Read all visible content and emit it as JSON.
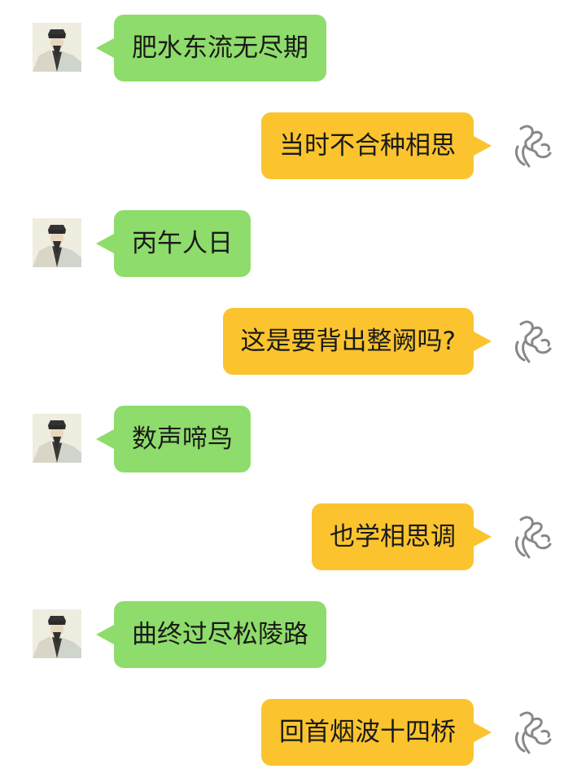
{
  "colors": {
    "incoming_bubble": "#8edc6b",
    "outgoing_bubble": "#fbc42e",
    "background": "#ffffff"
  },
  "messages": [
    {
      "side": "left",
      "text": "肥水东流无尽期",
      "avatar": "scholar-portrait"
    },
    {
      "side": "right",
      "text": "当时不合种相思",
      "avatar": "sketch-avatar"
    },
    {
      "side": "left",
      "text": "丙午人日",
      "avatar": "scholar-portrait"
    },
    {
      "side": "right",
      "text": "这是要背出整阙吗?",
      "avatar": "sketch-avatar"
    },
    {
      "side": "left",
      "text": "数声啼鸟",
      "avatar": "scholar-portrait"
    },
    {
      "side": "right",
      "text": "也学相思调",
      "avatar": "sketch-avatar"
    },
    {
      "side": "left",
      "text": "曲终过尽松陵路",
      "avatar": "scholar-portrait"
    },
    {
      "side": "right",
      "text": "回首烟波十四桥",
      "avatar": "sketch-avatar"
    }
  ]
}
